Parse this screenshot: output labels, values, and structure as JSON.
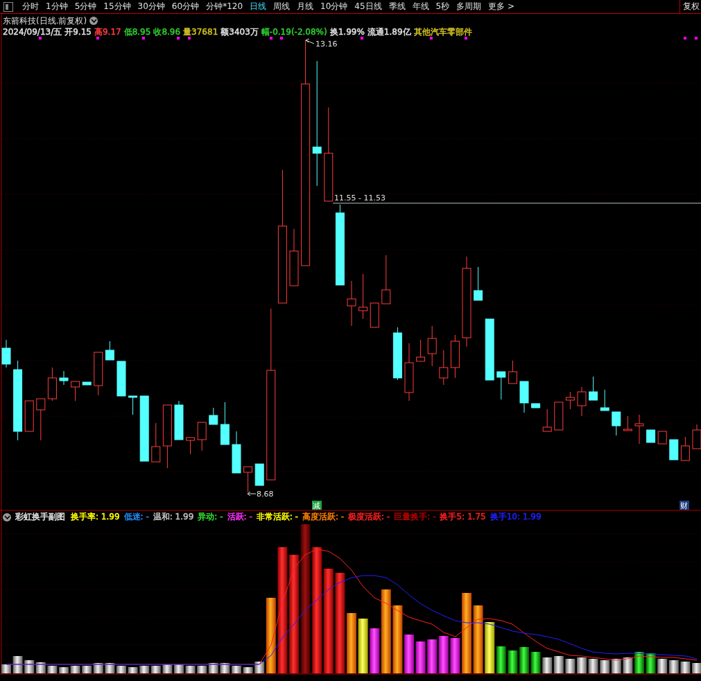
{
  "toolbar": {
    "tabs": [
      {
        "label": "分时",
        "selected": false
      },
      {
        "label": "1分钟",
        "selected": false
      },
      {
        "label": "5分钟",
        "selected": false
      },
      {
        "label": "15分钟",
        "selected": false
      },
      {
        "label": "30分钟",
        "selected": false
      },
      {
        "label": "60分钟",
        "selected": false
      },
      {
        "label": "分钟*120",
        "selected": false
      },
      {
        "label": "日线",
        "selected": true
      },
      {
        "label": "周线",
        "selected": false
      },
      {
        "label": "月线",
        "selected": false
      },
      {
        "label": "10分钟",
        "selected": false
      },
      {
        "label": "45日线",
        "selected": false
      },
      {
        "label": "季线",
        "selected": false
      },
      {
        "label": "年线",
        "selected": false
      },
      {
        "label": "5秒",
        "selected": false
      },
      {
        "label": "多周期",
        "selected": false
      },
      {
        "label": "更多 >",
        "selected": false
      }
    ],
    "adjust_button": "复权"
  },
  "chart": {
    "title": "东箭科技(日线.前复权)",
    "quote": [
      {
        "text": "2024/09/13/五",
        "color": "#e0e0e0"
      },
      {
        "text": "开9.15",
        "color": "#e0e0e0"
      },
      {
        "text": "高9.17",
        "color": "#ff3c3c"
      },
      {
        "text": "低8.95",
        "color": "#30d030"
      },
      {
        "text": "收8.96",
        "color": "#30d030"
      },
      {
        "text": "量37681",
        "color": "#d0c020"
      },
      {
        "text": "额3403万",
        "color": "#e0e0e0"
      },
      {
        "text": "幅-0.19(-2.08%)",
        "color": "#30d030"
      },
      {
        "text": "换1.99%",
        "color": "#e0e0e0"
      },
      {
        "text": "流通1.89亿",
        "color": "#e0e0e0"
      },
      {
        "text": "其他汽车零部件",
        "color": "#d0c020"
      }
    ],
    "high_label": "13.16",
    "low_label": "8.68",
    "range_label": "11.55 - 11.53",
    "markers": [
      {
        "text": "减",
        "color": "#20a040"
      },
      {
        "text": "财",
        "color": "#204080"
      }
    ]
  },
  "indicator": {
    "title": "彩虹换手副图",
    "legend": [
      {
        "text": "换手率: 1.99",
        "color": "#ffff00"
      },
      {
        "text": "低迷: -",
        "color": "#1e90ff"
      },
      {
        "text": "温和: 1.99",
        "color": "#c0c0c0"
      },
      {
        "text": "异动: -",
        "color": "#30e030"
      },
      {
        "text": "活跃: -",
        "color": "#ff30ff"
      },
      {
        "text": "非常活跃: -",
        "color": "#ffff00"
      },
      {
        "text": "高度活跃: -",
        "color": "#ff8000"
      },
      {
        "text": "极度活跃: -",
        "color": "#ff2020"
      },
      {
        "text": "巨量换手: -",
        "color": "#b00000"
      },
      {
        "text": "换手5: 1.75",
        "color": "#ff2020"
      },
      {
        "text": "换手10: 1.99",
        "color": "#2020ff"
      }
    ]
  }
}
